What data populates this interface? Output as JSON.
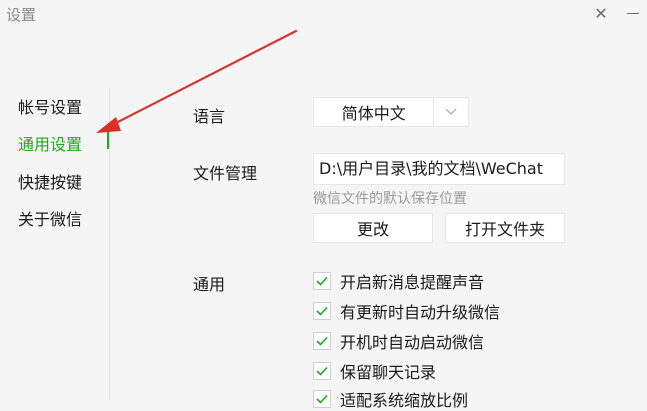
{
  "window": {
    "title": "设置",
    "close_glyph": "✕"
  },
  "sidebar": {
    "items": [
      {
        "label": "帐号设置",
        "active": false
      },
      {
        "label": "通用设置",
        "active": true
      },
      {
        "label": "快捷按键",
        "active": false
      },
      {
        "label": "关于微信",
        "active": false
      }
    ]
  },
  "settings": {
    "language": {
      "label": "语言",
      "value": "简体中文"
    },
    "file_management": {
      "label": "文件管理",
      "path": "D:\\用户目录\\我的文档\\WeChat",
      "hint": "微信文件的默认保存位置",
      "change_label": "更改",
      "open_folder_label": "打开文件夹"
    },
    "general": {
      "label": "通用",
      "options": [
        {
          "label": "开启新消息提醒声音",
          "checked": true
        },
        {
          "label": "有更新时自动升级微信",
          "checked": true
        },
        {
          "label": "开机时自动启动微信",
          "checked": true
        },
        {
          "label": "保留聊天记录",
          "checked": true
        },
        {
          "label": "适配系统缩放比例",
          "checked": true
        }
      ]
    }
  },
  "colors": {
    "accent_green": "#1aad19",
    "annotation_arrow": "#d9302b"
  }
}
